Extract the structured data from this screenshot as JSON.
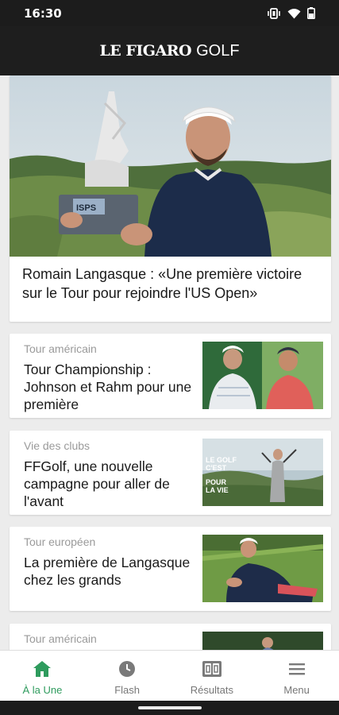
{
  "status_bar": {
    "time": "16:30"
  },
  "header": {
    "brand_main": "LE FIGARO",
    "brand_sub": "GOLF"
  },
  "hero": {
    "title": "Romain Langasque : «Une première victoire sur le Tour pour rejoindre l'US Open»",
    "trophy_text": "ISPS"
  },
  "articles": [
    {
      "category": "Tour américain",
      "title": "Tour Championship : Johnson et Rahm pour une première"
    },
    {
      "category": "Vie des clubs",
      "title": "FFGolf, une nouvelle campagne pour aller de l'avant",
      "thumb_text": [
        "LE GOLF",
        "C'EST",
        "POUR",
        "LA VIE"
      ]
    },
    {
      "category": "Tour européen",
      "title": "La première de Langasque chez les grands"
    },
    {
      "category": "Tour américain",
      "title": ""
    }
  ],
  "bottom_nav": {
    "items": [
      {
        "label": "À la Une",
        "icon": "home-icon",
        "active": true
      },
      {
        "label": "Flash",
        "icon": "clock-icon",
        "active": false
      },
      {
        "label": "Résultats",
        "icon": "scoreboard-icon",
        "active": false
      },
      {
        "label": "Menu",
        "icon": "menu-icon",
        "active": false
      }
    ]
  },
  "colors": {
    "accent": "#2e9b5d",
    "header_bg": "#1e1e1e",
    "page_bg": "#ececec"
  }
}
